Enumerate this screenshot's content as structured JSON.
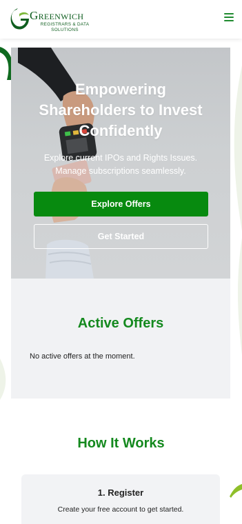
{
  "header": {
    "logo_name": "Greenwich",
    "logo_tagline_line1": "REGISTRARS & DATA",
    "logo_tagline_line2": "SOLUTIONS",
    "menu_icon": "hamburger-menu-icon"
  },
  "hero": {
    "title_line1": "Empowering",
    "title_line2": "Shareholders to Invest",
    "title_line3": "Confidently",
    "subtitle_line1": "Explore current IPOs and Rights Issues.",
    "subtitle_line2": "Manage subscriptions seamlessly.",
    "primary_button": "Explore Offers",
    "secondary_button": "Get Started"
  },
  "offers": {
    "title": "Active Offers",
    "empty_message": "No active offers at the moment."
  },
  "how_it_works": {
    "title": "How It Works",
    "steps": [
      {
        "title": "1. Register",
        "description": "Create your free account to get started."
      }
    ]
  },
  "colors": {
    "brand_green": "#0f5e1f",
    "accent_green": "#078a0f",
    "heading_green": "#14891e",
    "panel_gray": "#f1f2f4"
  }
}
